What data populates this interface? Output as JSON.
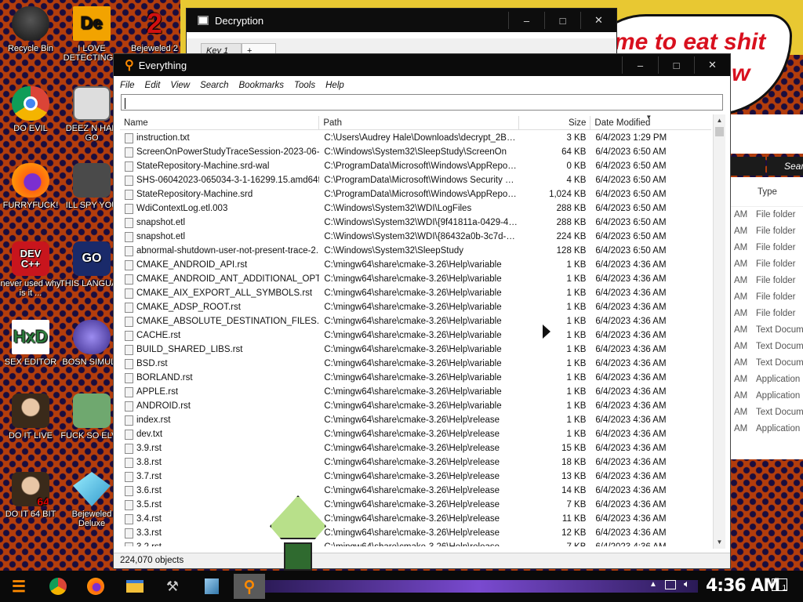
{
  "desktop": {
    "icons_left": [
      {
        "label": "Recycle Bin"
      },
      {
        "label": "DO EVIL"
      },
      {
        "label": "FURRYFUCK!"
      },
      {
        "label": "never used why is it ...",
        "badge": "DEV C++"
      },
      {
        "label": "SEX EDITOR"
      },
      {
        "label": "DO IT LIVE"
      },
      {
        "label": "DO IT 64 BIT",
        "badge": "64"
      }
    ],
    "icons_second": [
      {
        "label": "I LOVE DETECTING...",
        "badge": "De"
      },
      {
        "label": "DEEZ N HAH GO"
      },
      {
        "label": "ILL SPY YOU"
      },
      {
        "label": "THIS LANGUAG",
        "badge": "GO"
      },
      {
        "label": "BOSN SIMULA"
      },
      {
        "label": "FUCK SO ELVE"
      },
      {
        "label": "Bejeweled Deluxe"
      }
    ],
    "icon_third_label": "Bejeweled 2",
    "speech_lines": [
      "me to eat shit",
      "w"
    ],
    "colors": {
      "accent_orange": "#ff8a00",
      "bg_orange": "#b33d0c",
      "dot_purple": "#1a0d3e"
    }
  },
  "decryption_window": {
    "title": "Decryption",
    "tab_label": "Key 1",
    "tab_add": "+"
  },
  "everything": {
    "title": "Everything",
    "menu": [
      "File",
      "Edit",
      "View",
      "Search",
      "Bookmarks",
      "Tools",
      "Help"
    ],
    "search_value": "",
    "columns": {
      "name": "Name",
      "path": "Path",
      "size": "Size",
      "date": "Date Modified"
    },
    "rows": [
      {
        "name": "instruction.txt",
        "path": "C:\\Users\\Audrey Hale\\Downloads\\decrypt_2BBb...",
        "size": "3 KB",
        "date": "6/4/2023 1:29 PM"
      },
      {
        "name": "ScreenOnPowerStudyTraceSession-2023-06-0...",
        "path": "C:\\Windows\\System32\\SleepStudy\\ScreenOn",
        "size": "64 KB",
        "date": "6/4/2023 6:50 AM"
      },
      {
        "name": "StateRepository-Machine.srd-wal",
        "path": "C:\\ProgramData\\Microsoft\\Windows\\AppRepository",
        "size": "0 KB",
        "date": "6/4/2023 6:50 AM"
      },
      {
        "name": "SHS-06042023-065034-3-1-16299.15.amd64f...",
        "path": "C:\\ProgramData\\Microsoft\\Windows Security Heal...",
        "size": "4 KB",
        "date": "6/4/2023 6:50 AM"
      },
      {
        "name": "StateRepository-Machine.srd",
        "path": "C:\\ProgramData\\Microsoft\\Windows\\AppRepository",
        "size": "1,024 KB",
        "date": "6/4/2023 6:50 AM"
      },
      {
        "name": "WdiContextLog.etl.003",
        "path": "C:\\Windows\\System32\\WDI\\LogFiles",
        "size": "288 KB",
        "date": "6/4/2023 6:50 AM"
      },
      {
        "name": "snapshot.etl",
        "path": "C:\\Windows\\System32\\WDI\\{9f41811a-0429-42a...",
        "size": "288 KB",
        "date": "6/4/2023 6:50 AM"
      },
      {
        "name": "snapshot.etl",
        "path": "C:\\Windows\\System32\\WDI\\{86432a0b-3c7d-4d...",
        "size": "224 KB",
        "date": "6/4/2023 6:50 AM"
      },
      {
        "name": "abnormal-shutdown-user-not-present-trace-2...",
        "path": "C:\\Windows\\System32\\SleepStudy",
        "size": "128 KB",
        "date": "6/4/2023 6:50 AM"
      },
      {
        "name": "CMAKE_ANDROID_API.rst",
        "path": "C:\\mingw64\\share\\cmake-3.26\\Help\\variable",
        "size": "1 KB",
        "date": "6/4/2023 4:36 AM"
      },
      {
        "name": "CMAKE_ANDROID_ANT_ADDITIONAL_OPTIO...",
        "path": "C:\\mingw64\\share\\cmake-3.26\\Help\\variable",
        "size": "1 KB",
        "date": "6/4/2023 4:36 AM"
      },
      {
        "name": "CMAKE_AIX_EXPORT_ALL_SYMBOLS.rst",
        "path": "C:\\mingw64\\share\\cmake-3.26\\Help\\variable",
        "size": "1 KB",
        "date": "6/4/2023 4:36 AM"
      },
      {
        "name": "CMAKE_ADSP_ROOT.rst",
        "path": "C:\\mingw64\\share\\cmake-3.26\\Help\\variable",
        "size": "1 KB",
        "date": "6/4/2023 4:36 AM"
      },
      {
        "name": "CMAKE_ABSOLUTE_DESTINATION_FILES.rst",
        "path": "C:\\mingw64\\share\\cmake-3.26\\Help\\variable",
        "size": "1 KB",
        "date": "6/4/2023 4:36 AM"
      },
      {
        "name": "CACHE.rst",
        "path": "C:\\mingw64\\share\\cmake-3.26\\Help\\variable",
        "size": "1 KB",
        "date": "6/4/2023 4:36 AM"
      },
      {
        "name": "BUILD_SHARED_LIBS.rst",
        "path": "C:\\mingw64\\share\\cmake-3.26\\Help\\variable",
        "size": "1 KB",
        "date": "6/4/2023 4:36 AM"
      },
      {
        "name": "BSD.rst",
        "path": "C:\\mingw64\\share\\cmake-3.26\\Help\\variable",
        "size": "1 KB",
        "date": "6/4/2023 4:36 AM"
      },
      {
        "name": "BORLAND.rst",
        "path": "C:\\mingw64\\share\\cmake-3.26\\Help\\variable",
        "size": "1 KB",
        "date": "6/4/2023 4:36 AM"
      },
      {
        "name": "APPLE.rst",
        "path": "C:\\mingw64\\share\\cmake-3.26\\Help\\variable",
        "size": "1 KB",
        "date": "6/4/2023 4:36 AM"
      },
      {
        "name": "ANDROID.rst",
        "path": "C:\\mingw64\\share\\cmake-3.26\\Help\\variable",
        "size": "1 KB",
        "date": "6/4/2023 4:36 AM"
      },
      {
        "name": "index.rst",
        "path": "C:\\mingw64\\share\\cmake-3.26\\Help\\release",
        "size": "1 KB",
        "date": "6/4/2023 4:36 AM"
      },
      {
        "name": "dev.txt",
        "path": "C:\\mingw64\\share\\cmake-3.26\\Help\\release",
        "size": "1 KB",
        "date": "6/4/2023 4:36 AM"
      },
      {
        "name": "3.9.rst",
        "path": "C:\\mingw64\\share\\cmake-3.26\\Help\\release",
        "size": "15 KB",
        "date": "6/4/2023 4:36 AM"
      },
      {
        "name": "3.8.rst",
        "path": "C:\\mingw64\\share\\cmake-3.26\\Help\\release",
        "size": "18 KB",
        "date": "6/4/2023 4:36 AM"
      },
      {
        "name": "3.7.rst",
        "path": "C:\\mingw64\\share\\cmake-3.26\\Help\\release",
        "size": "13 KB",
        "date": "6/4/2023 4:36 AM"
      },
      {
        "name": "3.6.rst",
        "path": "C:\\mingw64\\share\\cmake-3.26\\Help\\release",
        "size": "14 KB",
        "date": "6/4/2023 4:36 AM"
      },
      {
        "name": "3.5.rst",
        "path": "C:\\mingw64\\share\\cmake-3.26\\Help\\release",
        "size": "7 KB",
        "date": "6/4/2023 4:36 AM"
      },
      {
        "name": "3.4.rst",
        "path": "C:\\mingw64\\share\\cmake-3.26\\Help\\release",
        "size": "11 KB",
        "date": "6/4/2023 4:36 AM"
      },
      {
        "name": "3.3.rst",
        "path": "C:\\mingw64\\share\\cmake-3.26\\Help\\release",
        "size": "12 KB",
        "date": "6/4/2023 4:36 AM"
      },
      {
        "name": "3.2.rst",
        "path": "C:\\mingw64\\share\\cmake-3.26\\Help\\release",
        "size": "7 KB",
        "date": "6/4/2023 4:36 AM"
      }
    ],
    "status": "224,070 objects"
  },
  "explorer_bg": {
    "search_label": "Sear",
    "type_header": "Type",
    "rows": [
      {
        "prefix": "AM",
        "type": "File folder"
      },
      {
        "prefix": "AM",
        "type": "File folder"
      },
      {
        "prefix": "AM",
        "type": "File folder"
      },
      {
        "prefix": "AM",
        "type": "File folder"
      },
      {
        "prefix": "AM",
        "type": "File folder"
      },
      {
        "prefix": "AM",
        "type": "File folder"
      },
      {
        "prefix": "AM",
        "type": "File folder"
      },
      {
        "prefix": "AM",
        "type": "Text Docum"
      },
      {
        "prefix": "AM",
        "type": "Text Docum"
      },
      {
        "prefix": "AM",
        "type": "Text Docum"
      },
      {
        "prefix": "AM",
        "type": "Application"
      },
      {
        "prefix": "AM",
        "type": "Application"
      },
      {
        "prefix": "AM",
        "type": "Text Docum"
      },
      {
        "prefix": "AM",
        "type": "Application"
      }
    ]
  },
  "taskbar": {
    "clock": "4:36 AM",
    "notification_count": "1",
    "apps": [
      "start-icon",
      "chrome-icon",
      "firefox-icon",
      "file-explorer-icon",
      "pickaxe-icon",
      "notepad-icon",
      "everything-search-icon"
    ]
  }
}
